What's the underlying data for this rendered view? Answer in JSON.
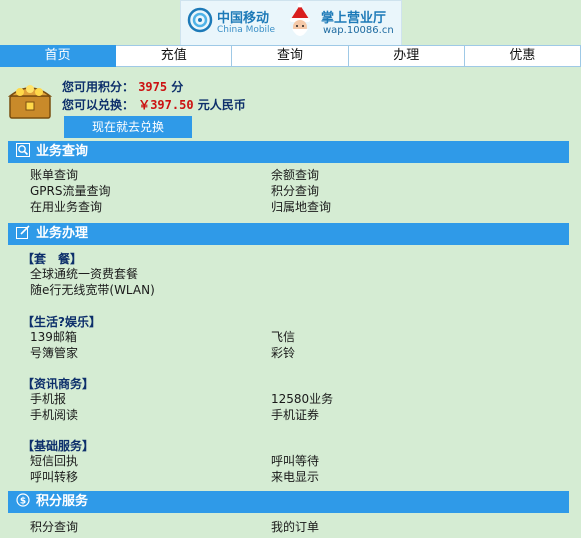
{
  "banner": {
    "brand_cn": "中国移动",
    "brand_en": "China Mobile",
    "palace": "掌上营业厅",
    "url": "wap.10086.cn"
  },
  "nav": {
    "tabs": [
      {
        "label": "首页"
      },
      {
        "label": "充值"
      },
      {
        "label": "查询"
      },
      {
        "label": "办理"
      },
      {
        "label": "优惠"
      }
    ]
  },
  "points": {
    "available_label": "您可用积分：",
    "available_value": "3975",
    "available_unit": "分",
    "exchange_label": "您可以兑换：",
    "exchange_value": "￥397.50",
    "exchange_unit": "元人民币",
    "redeem_button": "现在就去兑换"
  },
  "sections": {
    "query": {
      "title": "业务查询",
      "items": [
        "账单查询",
        "余额查询",
        "GPRS流量查询",
        "积分查询",
        "在用业务查询",
        "归属地查询"
      ]
    },
    "handle": {
      "title": "业务办理",
      "cat1": "【套　餐】",
      "cat1_items": [
        "全球通统一资费套餐",
        "随e行无线宽带(WLAN)"
      ],
      "cat2": "【生活?娱乐】",
      "cat2_items": [
        "139邮箱",
        "飞信",
        "号簿管家",
        "彩铃"
      ],
      "cat3": "【资讯商务】",
      "cat3_items": [
        "手机报",
        "12580业务",
        "手机阅读",
        "手机证券"
      ],
      "cat4": "【基础服务】",
      "cat4_items": [
        "短信回执",
        "呼叫等待",
        "呼叫转移",
        "来电显示"
      ]
    },
    "points_service": {
      "title": "积分服务",
      "items": [
        "积分查询",
        "我的订单"
      ]
    }
  },
  "colors": {
    "accent": "#2f9ae8",
    "background": "#d5ecd3",
    "value_red": "#cc1111",
    "label_navy": "#0d2f6b"
  }
}
